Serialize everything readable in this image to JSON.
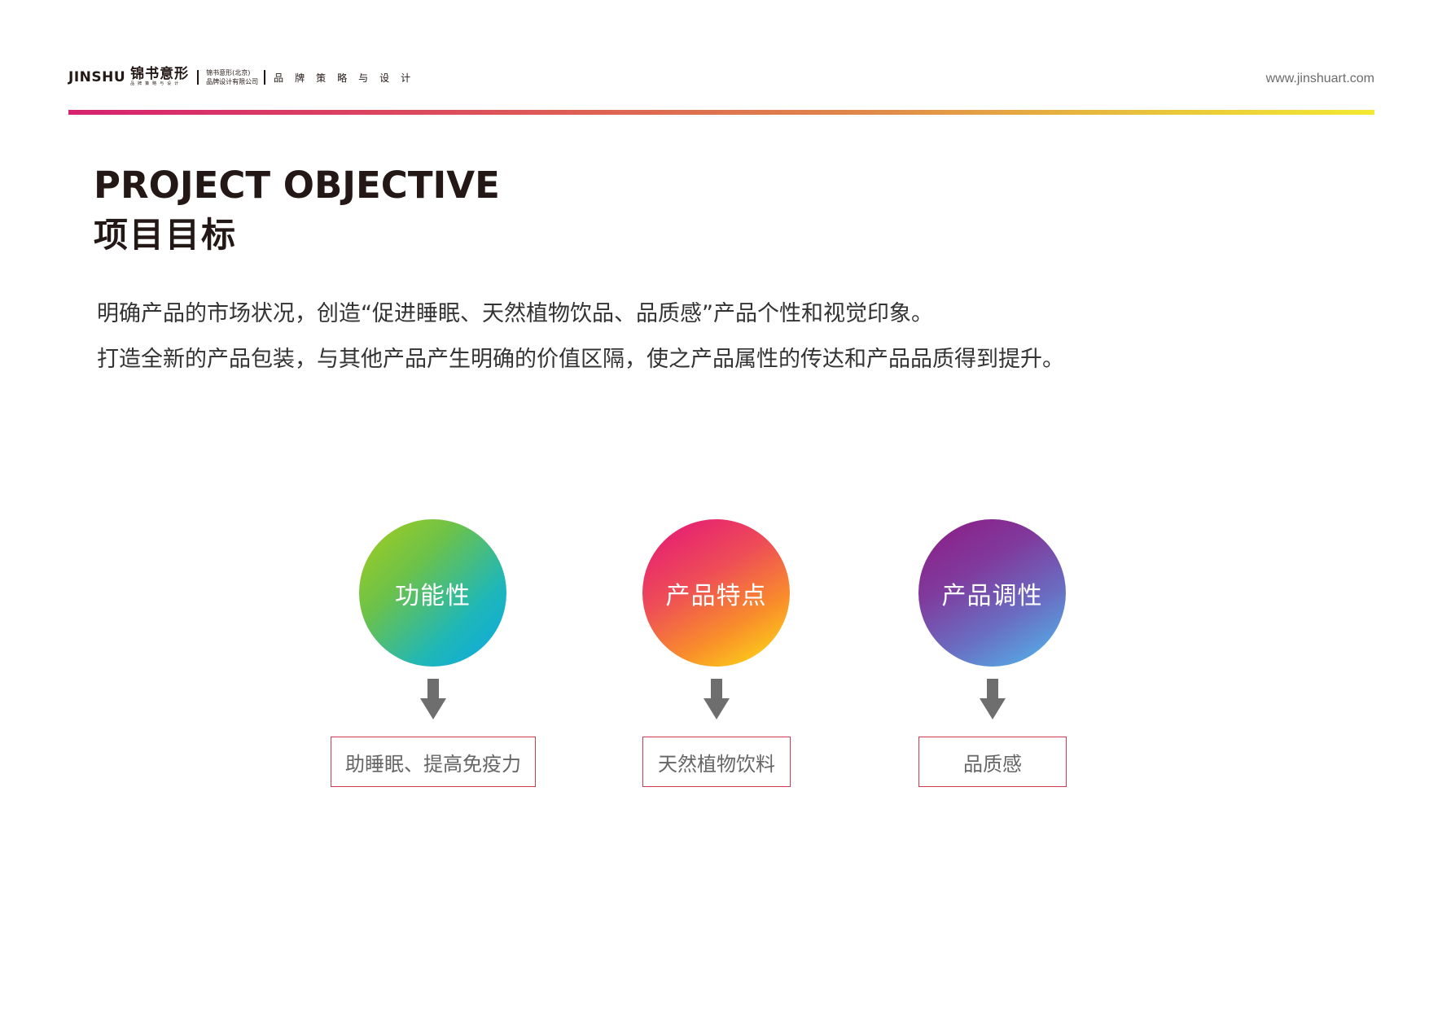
{
  "header": {
    "logo_en": "JINSHU",
    "logo_cn": "锦书意形",
    "logo_cn_sub": "品牌策略与设计",
    "company_line1": "锦书意形(北京)",
    "company_line2": "品牌设计有限公司",
    "tagline": "品牌策略与设计",
    "website": "www.jinshuart.com"
  },
  "title": {
    "en": "PROJECT OBJECTIVE",
    "cn": "项目目标"
  },
  "description": {
    "line1": "明确产品的市场状况，创造“促进睡眠、天然植物饮品、品质感”产品个性和视觉印象。",
    "line2": "打造全新的产品包装，与其他产品产生明确的价值区隔，使之产品属性的传达和产品品质得到提升。"
  },
  "objectives": [
    {
      "circle": "功能性",
      "label": "助睡眠、提高免疫力"
    },
    {
      "circle": "产品特点",
      "label": "天然植物饮料"
    },
    {
      "circle": "产品调性",
      "label": "品质感"
    }
  ],
  "colors": {
    "rule_start": "#d6226f",
    "rule_end": "#f3e832",
    "box_border": "#d23a4d",
    "arrow": "#6e6e6e",
    "circle1": [
      "#a8cd1c",
      "#0aa7e6"
    ],
    "circle2": [
      "#e4127a",
      "#fde713"
    ],
    "circle3": [
      "#8e1a84",
      "#4fbdf0"
    ]
  }
}
